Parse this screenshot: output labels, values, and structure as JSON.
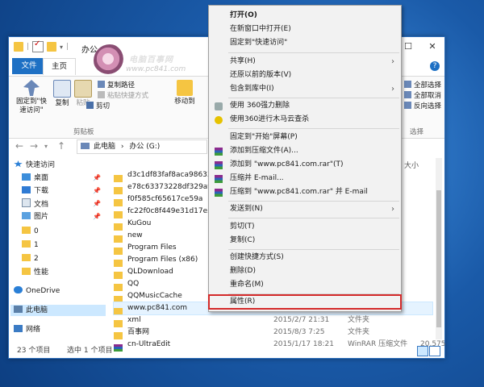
{
  "window": {
    "title": "办公 (G:)",
    "qat_sep": "|"
  },
  "tabs": {
    "file": "文件",
    "home": "主页"
  },
  "ribbon": {
    "pin": "固定到\"快速访问\"",
    "copy": "复制",
    "paste": "粘贴",
    "copy_path": "复制路径",
    "paste_shortcut": "粘贴快捷方式",
    "cut": "剪切",
    "move_to": "移动到",
    "clipboard_group": "剪贴板",
    "select_all": "全部选择",
    "select_none": "全部取消",
    "invert_select": "反向选择",
    "select_group": "选择"
  },
  "address": {
    "root": "此电脑",
    "sep": "›",
    "drive": "办公 (G:)"
  },
  "nav": {
    "quick_access": "快速访问",
    "desktop": "桌面",
    "downloads": "下载",
    "documents": "文档",
    "pictures": "图片",
    "f0": "0",
    "f1": "1",
    "f2": "2",
    "perf": "性能",
    "onedrive": "OneDrive",
    "this_pc": "此电脑",
    "network": "网络",
    "pin_glyph": "📌"
  },
  "list": {
    "col_size": "大小",
    "rows": [
      {
        "name": "d3c1df83faf8aca9863326",
        "date": "",
        "type": "",
        "size": ""
      },
      {
        "name": "e78c63373228df329af2d",
        "date": "",
        "type": "",
        "size": ""
      },
      {
        "name": "f0f585cf65617ce59a",
        "date": "",
        "type": "",
        "size": ""
      },
      {
        "name": "fc22f0c8f449e31d17e35b",
        "date": "",
        "type": "",
        "size": ""
      },
      {
        "name": "KuGou",
        "date": "",
        "type": "",
        "size": ""
      },
      {
        "name": "new",
        "date": "",
        "type": "",
        "size": ""
      },
      {
        "name": "Program Files",
        "date": "",
        "type": "",
        "size": ""
      },
      {
        "name": "Program Files (x86)",
        "date": "",
        "type": "",
        "size": ""
      },
      {
        "name": "QLDownload",
        "date": "",
        "type": "",
        "size": ""
      },
      {
        "name": "QQ",
        "date": "",
        "type": "",
        "size": ""
      },
      {
        "name": "QQMusicCache",
        "date": "",
        "type": "",
        "size": ""
      },
      {
        "name": "www.pc841.com",
        "date": "2015/2/1 15:16",
        "type": "文件夹",
        "size": ""
      },
      {
        "name": "xml",
        "date": "2015/2/7 21:31",
        "type": "文件夹",
        "size": ""
      },
      {
        "name": "百事网",
        "date": "2015/8/3 7:25",
        "type": "文件夹",
        "size": ""
      },
      {
        "name": "cn-UltraEdit",
        "date": "2015/1/17 18:21",
        "type": "WinRAR 压缩文件",
        "size": "20,575"
      }
    ]
  },
  "status": {
    "count": "23 个项目",
    "selected": "选中 1 个项目"
  },
  "watermark": {
    "line1": "电脑百事网",
    "line2": "www.pc841.com"
  },
  "menu": {
    "open": "打开(O)",
    "open_new_window": "在新窗口中打开(E)",
    "pin_quick": "固定到\"快速访问\"",
    "share": "共享(H)",
    "restore": "还原以前的版本(V)",
    "include_lib": "包含到库中(I)",
    "s360_delete": "使用 360强力删除",
    "s360_scan": "使用360进行木马云查杀",
    "pin_start": "固定到\"开始\"屏幕(P)",
    "add_archive": "添加到压缩文件(A)...",
    "add_rar": "添加到 \"www.pc841.com.rar\"(T)",
    "compress_email": "压缩并 E-mail...",
    "compress_rar_email": "压缩到 \"www.pc841.com.rar\" 并 E-mail",
    "send_to": "发送到(N)",
    "cut": "剪切(T)",
    "copy": "复制(C)",
    "create_shortcut": "创建快捷方式(S)",
    "delete": "删除(D)",
    "rename": "重命名(M)",
    "properties": "属性(R)",
    "arrow": "›"
  }
}
